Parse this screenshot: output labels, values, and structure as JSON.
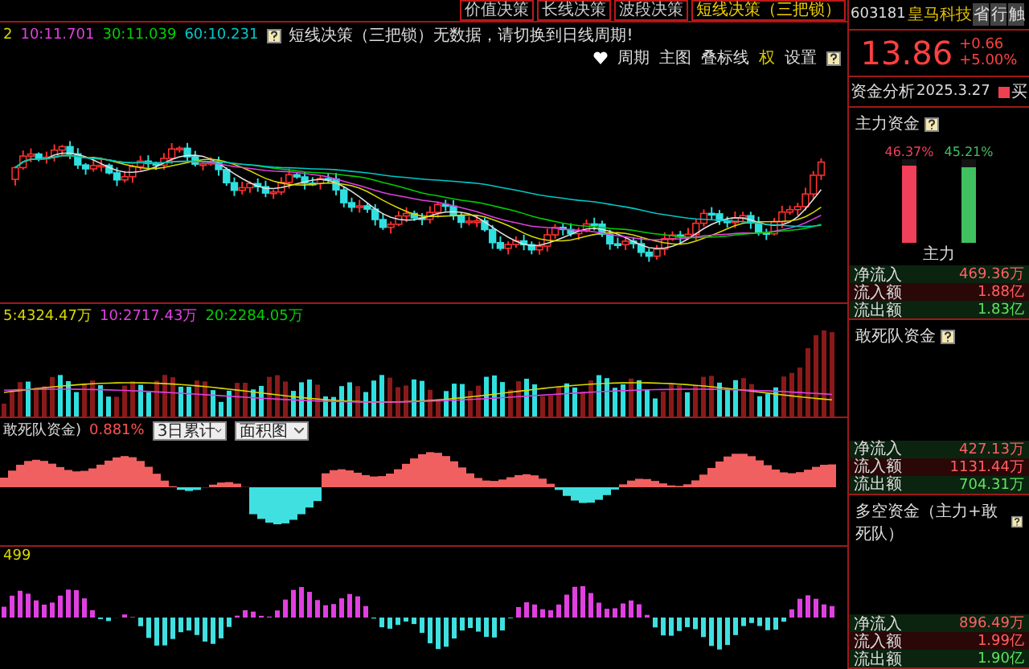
{
  "decision_tabs": [
    {
      "label": "价值决策",
      "selected": false
    },
    {
      "label": "长线决策",
      "selected": false
    },
    {
      "label": "波段决策",
      "selected": false
    },
    {
      "label": "短线决策（三把锁）",
      "selected": true
    }
  ],
  "main_chart": {
    "indicators": [
      {
        "text": "2",
        "color": "#d8d800"
      },
      {
        "text": "10:11.701",
        "color": "#e040e0"
      },
      {
        "text": "30:11.039",
        "color": "#00d000"
      },
      {
        "text": "60:10.231",
        "color": "#00c8c8"
      }
    ],
    "notice": "短线决策（三把锁）无数据，请切换到日线周期!",
    "toolbar": [
      "周期",
      "主图",
      "叠标线",
      "权",
      "设置"
    ]
  },
  "volume_panel": {
    "indicators": [
      {
        "text": "5:4324.47万",
        "color": "#d8d800"
      },
      {
        "text": "10:2717.43万",
        "color": "#e040e0"
      },
      {
        "text": "20:2284.05万",
        "color": "#00d000"
      }
    ]
  },
  "fund_panel": {
    "title": "敢死队资金)",
    "value": "0.881%",
    "dropdowns": [
      "3日累计",
      "面积图"
    ]
  },
  "bottom_panel": {
    "label": "499"
  },
  "quote": {
    "code": "603181",
    "name": "皇马科技",
    "actions": [
      "省",
      "行",
      "触"
    ],
    "price": "13.86",
    "change": "+0.66",
    "change_pct": "+5.00%"
  },
  "analysis": {
    "title": "资金分析",
    "date": "2025.3.27",
    "tag": "买"
  },
  "sections": [
    {
      "title": "主力资金",
      "bars": [
        {
          "label": "46.37%",
          "level": 0.92,
          "color": "#f0405a"
        },
        {
          "label": "45.21%",
          "level": 0.9,
          "color": "#40c060"
        }
      ],
      "bar_caption": "主力",
      "rows": [
        {
          "label": "净流入",
          "value": "469.36万"
        },
        {
          "label": "流入额",
          "value": "1.88亿"
        },
        {
          "label": "流出额",
          "value": "1.83亿"
        }
      ]
    },
    {
      "title": "敢死队资金",
      "rows": [
        {
          "label": "净流入",
          "value": "427.13万"
        },
        {
          "label": "流入额",
          "value": "1131.44万"
        },
        {
          "label": "流出额",
          "value": "704.31万"
        }
      ]
    },
    {
      "title": "多空资金（主力+敢死队）",
      "rows": [
        {
          "label": "净流入",
          "value": "896.49万"
        },
        {
          "label": "流入额",
          "value": "1.99亿"
        },
        {
          "label": "流出额",
          "value": "1.90亿"
        }
      ]
    }
  ]
}
